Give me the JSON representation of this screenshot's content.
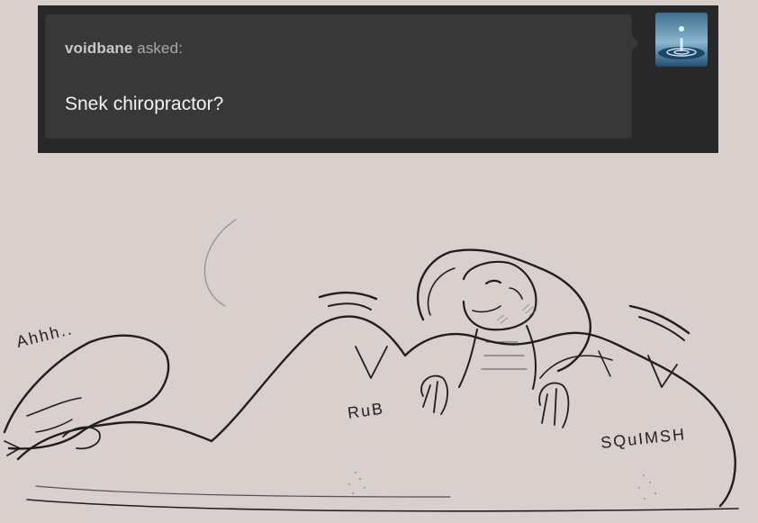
{
  "ask": {
    "asker": "voidbane",
    "asked_suffix": "asked:",
    "question": "Snek chiropractor?"
  },
  "avatar": {
    "icon": "water-drop-icon"
  },
  "artwork": {
    "sfx_ahhh": "Ahhh..",
    "sfx_rub": "RuB",
    "sfx_squish": "SQuIMSH"
  },
  "colors": {
    "page_bg": "#d9d0cd",
    "card_bg": "#282828",
    "bubble_bg": "#383838",
    "question_text": "#f2f2f2"
  }
}
